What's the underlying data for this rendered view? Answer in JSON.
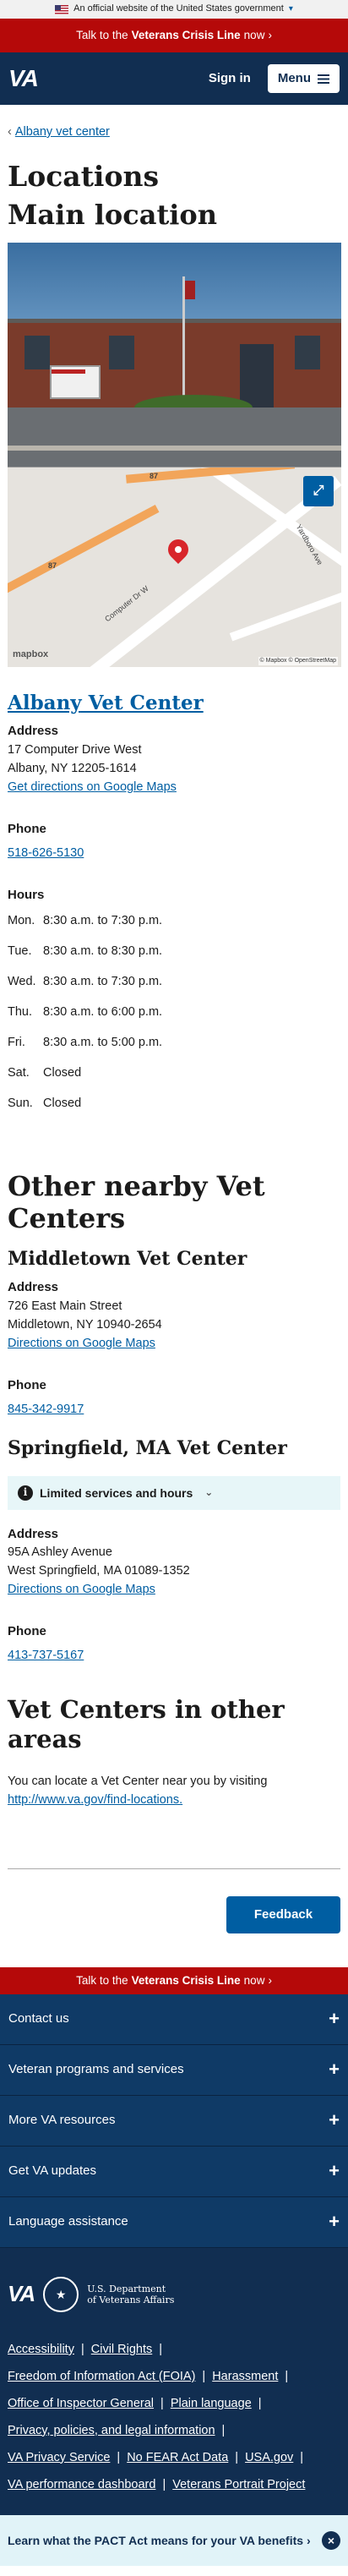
{
  "gov_banner": {
    "text": "An official website of the United States government",
    "chevron": "chevron-down-icon"
  },
  "crisis": {
    "prefix": "Talk to the",
    "bold": "Veterans Crisis Line",
    "suffix": "now",
    "arrow": "›"
  },
  "header": {
    "logo": "VA",
    "sign_in": "Sign in",
    "menu": "Menu"
  },
  "breadcrumb": {
    "arrow": "‹",
    "label": "Albany vet center"
  },
  "page": {
    "title": "Locations",
    "main_heading": "Main location"
  },
  "map": {
    "logo": "mapbox",
    "attribution": "© Mapbox © OpenStreetMap",
    "roads": [
      "Computer Dr W",
      "Yardboro Ave",
      "87",
      "87"
    ]
  },
  "main_center": {
    "name": "Albany Vet Center",
    "address_label": "Address",
    "address_line1": "17 Computer Drive West",
    "address_line2": "Albany, NY 12205-1614",
    "directions": "Get directions on Google Maps",
    "phone_label": "Phone",
    "phone": "518-626-5130",
    "hours_label": "Hours",
    "hours": [
      {
        "day": "Mon.",
        "time": "8:30 a.m. to 7:30 p.m."
      },
      {
        "day": "Tue.",
        "time": "8:30 a.m. to 8:30 p.m."
      },
      {
        "day": "Wed.",
        "time": "8:30 a.m. to 7:30 p.m."
      },
      {
        "day": "Thu.",
        "time": "8:30 a.m. to 6:00 p.m."
      },
      {
        "day": "Fri.",
        "time": "8:30 a.m. to 5:00 p.m."
      },
      {
        "day": "Sat.",
        "time": "Closed"
      },
      {
        "day": "Sun.",
        "time": "Closed"
      }
    ]
  },
  "nearby": {
    "heading": "Other nearby Vet Centers",
    "centers": [
      {
        "name": "Middletown Vet Center",
        "address_label": "Address",
        "line1": "726 East Main Street",
        "line2": "Middletown, NY 10940-2654",
        "directions": "Directions on Google Maps",
        "phone_label": "Phone",
        "phone": "845-342-9917"
      },
      {
        "name": "Springfield, MA Vet Center",
        "alert": "Limited services and hours",
        "address_label": "Address",
        "line1": "95A Ashley Avenue",
        "line2": "West Springfield, MA 01089-1352",
        "directions": "Directions on Google Maps",
        "phone_label": "Phone",
        "phone": "413-737-5167"
      }
    ]
  },
  "other_areas": {
    "heading": "Vet Centers in other areas",
    "text": "You can locate a Vet Center near you by visiting",
    "link": "http://www.va.gov/find-locations."
  },
  "feedback": "Feedback",
  "footer": {
    "accordions": [
      "Contact us",
      "Veteran programs and services",
      "More VA resources",
      "Get VA updates",
      "Language assistance"
    ],
    "logo": "VA",
    "dept_line1": "U.S. Department",
    "dept_line2": "of Veterans Affairs",
    "links": [
      "Accessibility",
      "Civil Rights",
      "Freedom of Information Act (FOIA)",
      "Harassment",
      "Office of Inspector General",
      "Plain language",
      "Privacy, policies, and legal information",
      "VA Privacy Service",
      "No FEAR Act Data",
      "USA.gov",
      "VA performance dashboard",
      "Veterans Portrait Project"
    ],
    "separator": "|"
  },
  "pact": {
    "text": "Learn what the PACT Act means for your VA benefits",
    "arrow": "›",
    "close": "×"
  },
  "colors": {
    "crisis_red": "#b50909",
    "navy": "#112e51",
    "link_blue": "#005ea2",
    "alert_bg": "#e7f6f8"
  }
}
